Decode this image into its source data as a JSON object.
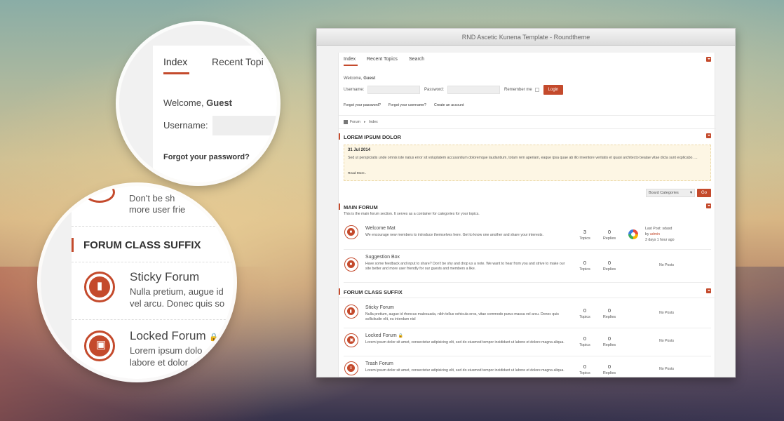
{
  "window": {
    "title": "RND Ascetic Kunena Template - Roundtheme"
  },
  "tabs": [
    {
      "label": "Index"
    },
    {
      "label": "Recent Topics"
    },
    {
      "label": "Search"
    }
  ],
  "login": {
    "welcome_prefix": "Welcome, ",
    "welcome_user": "Guest",
    "username_label": "Username:",
    "password_label": "Password:",
    "remember_label": "Remember me",
    "login_button": "Login",
    "links": [
      "Forgot your password?",
      "Forgot your username?",
      "Create an account"
    ]
  },
  "breadcrumb": {
    "items": [
      "Forum",
      "Index"
    ]
  },
  "announcement": {
    "title": "LOREM IPSUM DOLOR",
    "date": "31 Jul 2014",
    "text": "Sed ut perspiciatis unde omnis iste natus error sit voluptatem accusantium doloremque laudantium, totam rem aperiam, eaque ipsa quae ab illo inventore veritatis et quasi architecto beatae vitae dicta sunt explicabo. ...",
    "read_more": "Read More.."
  },
  "category_jump": {
    "selected": "Board Categories",
    "go_button": "Go"
  },
  "sections": [
    {
      "title": "MAIN FORUM",
      "description": "This is the main forum section. It serves as a container for categories for your topics.",
      "forums": [
        {
          "name": "Welcome Mat",
          "description": "We encourage new members to introduce themselves here. Get to know one another and share your interests.",
          "topics": "3",
          "replies": "0",
          "last_post_prefix": "Last Post: ",
          "last_post_title": "sdasd",
          "by_label": "by ",
          "author": "admin",
          "time": "3 days 1 hour ago"
        },
        {
          "name": "Suggestion Box",
          "description": "Have some feedback and input to share? Don't be shy and drop us a note. We want to hear from you and strive to make our site better and more user friendly for our guests and members a like.",
          "topics": "0",
          "replies": "0",
          "no_posts": "No Posts"
        }
      ]
    },
    {
      "title": "FORUM CLASS SUFFIX",
      "forums": [
        {
          "name": "Sticky Forum",
          "description": "Nulla pretium, augue id rhoncus malesuada, nibh tellus vehicula eros, vitae commodo purus massa vel arcu. Donec quis sollicitudin elit, eu interdum nisl",
          "topics": "0",
          "replies": "0",
          "no_posts": "No Posts"
        },
        {
          "name": "Locked Forum",
          "description": "Lorem ipsum dolor sit amet, consectetur adipisicing elit, sed do eiusmod tempor incididunt ut labore et dolore magna aliqua.",
          "topics": "0",
          "replies": "0",
          "no_posts": "No Posts"
        },
        {
          "name": "Trash Forum",
          "description": "Lorem ipsum dolor sit amet, consectetur adipisicing elit, sed do eiusmod tempor incididunt ut labore et dolore magna aliqua.",
          "topics": "0",
          "replies": "0",
          "no_posts": "No Posts"
        }
      ]
    }
  ],
  "labels": {
    "topics": "Topics",
    "replies": "Replies"
  },
  "magnifier_top": {
    "tab_index": "Index",
    "tab_recent": "Recent Topi",
    "welcome_prefix": "Welcome, ",
    "welcome_user": "Guest",
    "username_label": "Username:",
    "forgot": "Forgot your password?"
  },
  "magnifier_bottom": {
    "line1": "Don't be sh",
    "line2": "more user frie",
    "section_title": "FORUM CLASS SUFFIX",
    "sticky_name": "Sticky Forum",
    "sticky_l1": "Nulla pretium, augue id",
    "sticky_l2": "vel arcu. Donec quis so",
    "locked_name": "Locked Forum",
    "locked_l1": "Lorem ipsum dolo",
    "locked_l2": "labore et dolor"
  },
  "colors": {
    "accent": "#c44a2c",
    "announcement_bg": "#fdf6e4"
  },
  "icons": {
    "forum": "forum-bubble-icon",
    "sticky": "bookmark-icon",
    "locked": "lock-icon",
    "trash": "trash-icon"
  }
}
